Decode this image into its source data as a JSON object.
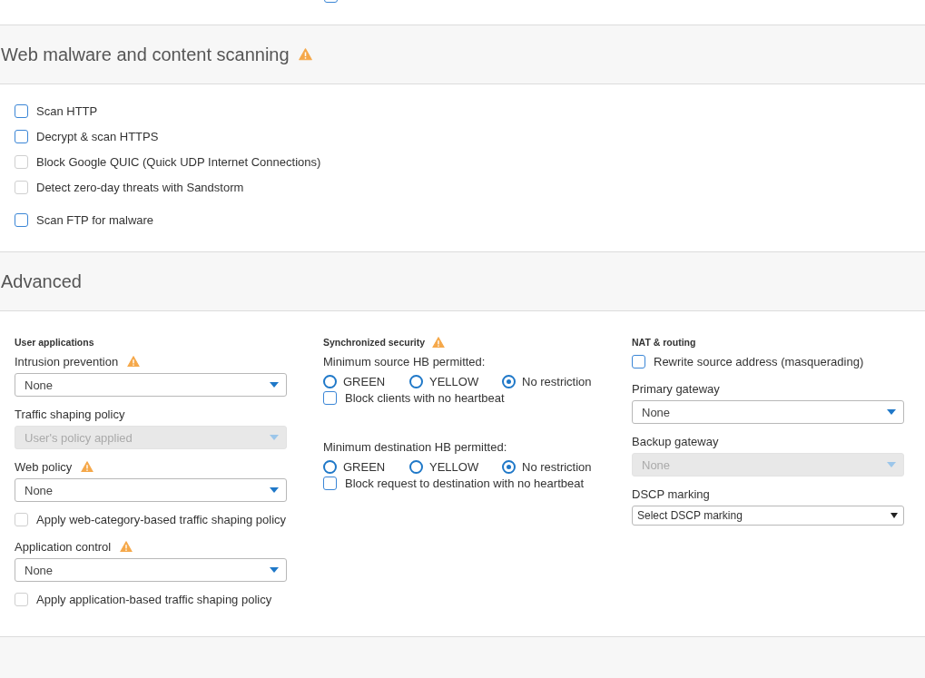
{
  "top_checkbox": {
    "checked": false
  },
  "sections": [
    {
      "title": "Web malware and content scanning",
      "warning": true,
      "groups": [
        [
          {
            "label": "Scan HTTP",
            "checked": false,
            "disabled": false
          },
          {
            "label": "Decrypt & scan HTTPS",
            "checked": false,
            "disabled": false
          },
          {
            "label": "Block Google QUIC (Quick UDP Internet Connections)",
            "checked": false,
            "disabled": true
          },
          {
            "label": "Detect zero-day threats with Sandstorm",
            "checked": false,
            "disabled": true
          }
        ],
        [
          {
            "label": "Scan FTP for malware",
            "checked": false,
            "disabled": false
          }
        ]
      ]
    },
    {
      "title": "Advanced",
      "warning": false,
      "columns": [
        {
          "heading": "User applications",
          "warning": false,
          "items": [
            {
              "kind": "label",
              "text": "Intrusion prevention",
              "warning": true
            },
            {
              "kind": "select",
              "value": "None",
              "disabled": false
            },
            {
              "kind": "label",
              "text": "Traffic shaping policy",
              "warning": false
            },
            {
              "kind": "select",
              "value": "User's policy applied",
              "disabled": true
            },
            {
              "kind": "label",
              "text": "Web policy",
              "warning": true
            },
            {
              "kind": "select",
              "value": "None",
              "disabled": false
            },
            {
              "kind": "checkbox",
              "label": "Apply web-category-based traffic shaping policy",
              "checked": false,
              "disabled": true
            },
            {
              "kind": "label",
              "text": "Application control",
              "warning": true
            },
            {
              "kind": "select",
              "value": "None",
              "disabled": false
            },
            {
              "kind": "checkbox",
              "label": "Apply application-based traffic shaping policy",
              "checked": false,
              "disabled": true
            }
          ]
        },
        {
          "heading": "Synchronized security",
          "warning": true,
          "items": [
            {
              "kind": "label",
              "text": "Minimum source HB permitted:",
              "warning": false
            },
            {
              "kind": "radio_group",
              "options": [
                {
                  "label": "GREEN",
                  "selected": false
                },
                {
                  "label": "YELLOW",
                  "selected": false
                },
                {
                  "label": "No restriction",
                  "selected": true
                }
              ]
            },
            {
              "kind": "checkbox",
              "label": "Block clients with no heartbeat",
              "checked": false,
              "disabled": false
            },
            {
              "kind": "spacer"
            },
            {
              "kind": "label",
              "text": "Minimum destination HB permitted:",
              "warning": false
            },
            {
              "kind": "radio_group",
              "options": [
                {
                  "label": "GREEN",
                  "selected": false
                },
                {
                  "label": "YELLOW",
                  "selected": false
                },
                {
                  "label": "No restriction",
                  "selected": true
                }
              ]
            },
            {
              "kind": "checkbox",
              "label": "Block request to destination with no heartbeat",
              "checked": false,
              "disabled": false
            }
          ]
        },
        {
          "heading": "NAT & routing",
          "warning": false,
          "items": [
            {
              "kind": "checkbox",
              "label": "Rewrite source address (masquerading)",
              "checked": false,
              "disabled": false
            },
            {
              "kind": "label",
              "text": "Primary gateway",
              "warning": false
            },
            {
              "kind": "select",
              "value": "None",
              "disabled": false
            },
            {
              "kind": "label",
              "text": "Backup gateway",
              "warning": false
            },
            {
              "kind": "select",
              "value": "None",
              "disabled": true
            },
            {
              "kind": "label",
              "text": "DSCP marking",
              "warning": false
            },
            {
              "kind": "native_select",
              "value": "Select DSCP marking"
            }
          ]
        }
      ]
    }
  ]
}
